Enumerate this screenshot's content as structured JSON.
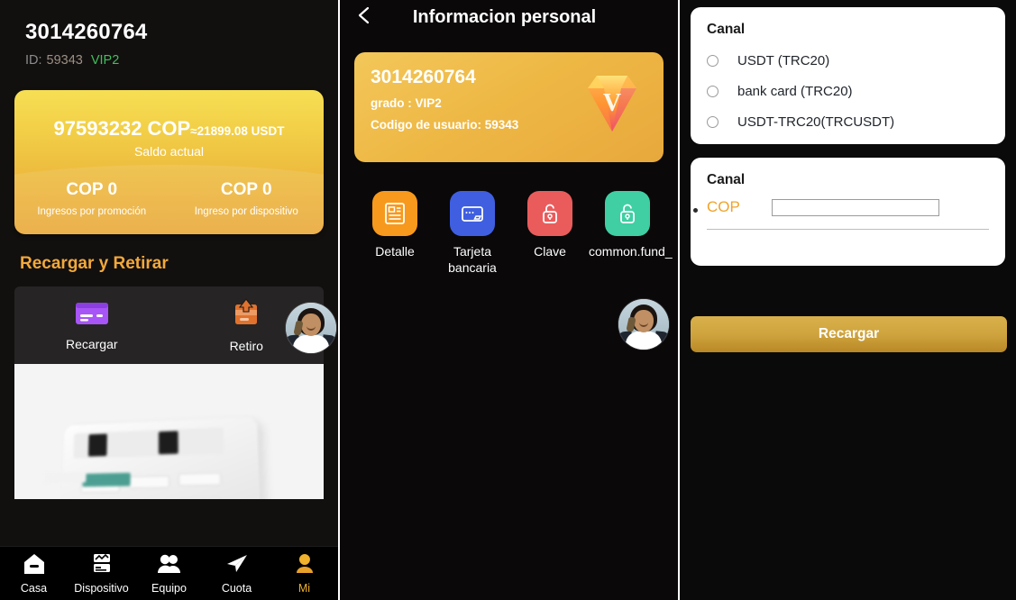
{
  "left_panel": {
    "account_number": "3014260764",
    "id_label": "ID:",
    "id_value": "59343",
    "vip_badge": "VIP2",
    "balance_card": {
      "amount": "97593232 COP",
      "usdt_equivalent": "≈21899.08 USDT",
      "caption": "Saldo actual",
      "stats": [
        {
          "value": "COP 0",
          "label": "Ingresos por promoción"
        },
        {
          "value": "COP 0",
          "label": "Ingreso por dispositivo"
        }
      ]
    },
    "section_title": "Recargar y Retirar",
    "actions": [
      {
        "label": "Recargar",
        "icon": "credit-card-icon",
        "color": "#a855f7"
      },
      {
        "label": "Retiro",
        "icon": "withdraw-upload-icon",
        "color": "#e07b39"
      }
    ],
    "tabbar": [
      {
        "label": "Casa",
        "icon": "home-icon",
        "active": false
      },
      {
        "label": "Dispositivo",
        "icon": "device-icon",
        "active": false
      },
      {
        "label": "Equipo",
        "icon": "team-icon",
        "active": false
      },
      {
        "label": "Cuota",
        "icon": "send-plane-icon",
        "active": false
      },
      {
        "label": "Mi",
        "icon": "user-icon",
        "active": true
      }
    ]
  },
  "mid_panel": {
    "back_icon": "chevron-left-icon",
    "title": "Informacion personal",
    "vip_card": {
      "account_number": "3014260764",
      "grade": "grado : VIP2",
      "user_code": "Codigo de usuario: 59343",
      "gem_letter": "V"
    },
    "menu": [
      {
        "label": "Detalle",
        "icon": "document-detail-icon",
        "color": "#f7991c"
      },
      {
        "label": "Tarjeta bancaria",
        "icon": "bank-card-icon",
        "color": "#3f5fe0"
      },
      {
        "label": "Clave",
        "icon": "lock-open-icon",
        "color": "#ea5c5c"
      },
      {
        "label": "common.fund_",
        "icon": "lock-open-icon",
        "color": "#3fcfa2"
      }
    ]
  },
  "right_panel": {
    "channel_card": {
      "title": "Canal",
      "options": [
        {
          "label": "USDT (TRC20)",
          "selected": false
        },
        {
          "label": "bank card (TRC20)",
          "selected": false
        },
        {
          "label": "USDT-TRC20(TRCUSDT)",
          "selected": false
        }
      ]
    },
    "amount_card": {
      "title": "Canal",
      "currency_label": "COP",
      "amount_value": "",
      "amount_placeholder": ""
    },
    "submit_label": "Recargar"
  },
  "colors": {
    "gold": "#f0b22c",
    "gold_dark": "#e8a83a",
    "accent_green": "#3fbf5a",
    "panel_bg": "#120f0f",
    "card_white": "#ffffff"
  }
}
